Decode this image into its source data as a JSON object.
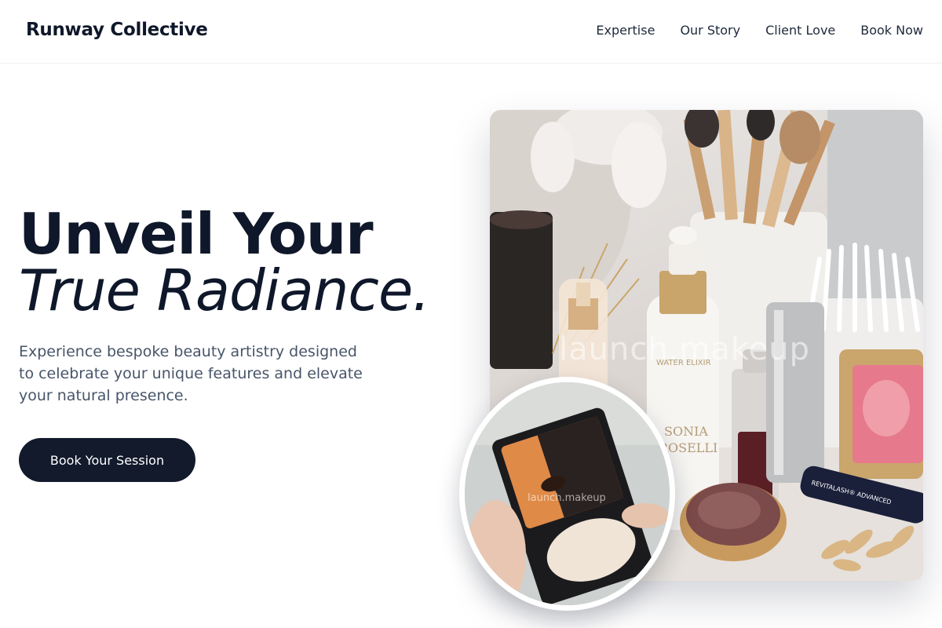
{
  "header": {
    "brand": "Runway Collective",
    "nav": [
      {
        "label": "Expertise"
      },
      {
        "label": "Our Story"
      },
      {
        "label": "Client Love"
      },
      {
        "label": "Book Now"
      }
    ]
  },
  "hero": {
    "headline_line1": "Unveil Your",
    "headline_line2": "True Radiance.",
    "subcopy": "Experience bespoke beauty artistry designed to celebrate your unique features and elevate your natural presence.",
    "cta_label": "Book Your Session"
  },
  "media": {
    "watermark": "launch.makeup",
    "product_labels": [
      "WATER ELIXIR",
      "SONIA",
      "ROSELLI",
      "REVITALASH® ADVANCED"
    ]
  },
  "colors": {
    "text_dark": "#0f172a",
    "text_muted": "#475569",
    "button_bg": "#121a2c",
    "button_text": "#ffffff"
  }
}
